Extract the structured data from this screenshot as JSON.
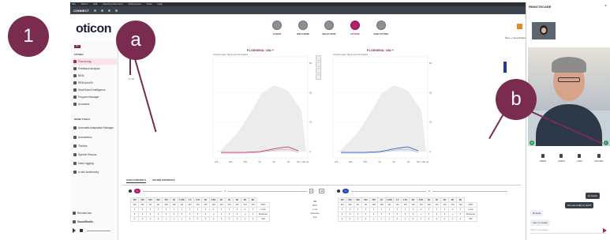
{
  "callouts": {
    "one": "1",
    "a": "a",
    "b": "b"
  },
  "menubar": [
    "File",
    "Oticon",
    "Edit",
    "Hearing Instrument",
    "Preferences",
    "Tools",
    "Help"
  ],
  "toolbar": {
    "connect": "CONNECT"
  },
  "logo": "oticon",
  "steps": [
    {
      "label": "CLIENT"
    },
    {
      "label": "WELCOME"
    },
    {
      "label": "SELECTION"
    },
    {
      "label": "FITTING"
    },
    {
      "label": "END FITTING"
    }
  ],
  "more_label": "More + Specifications",
  "sidebar": {
    "tab": "R1",
    "fitting_header": "FITTING",
    "items": [
      "Fine-tuning",
      "Feedback Analysis",
      "REM",
      "REM AutoFit",
      "MoreSound Intelligence",
      "Program Manager",
      "Acoustics"
    ],
    "more_tools_header": "MORE TOOLS",
    "tools": [
      "Automatic Adaptation Manager",
      "Autometrics",
      "Tinnitus",
      "Speech Rescue",
      "Data Logging",
      "In-situ Audiometry"
    ],
    "remotecare": "RemoteCare",
    "soundstudio": "SoundStudio"
  },
  "left_value": "75 dB",
  "charts": [
    {
      "title": "P1-GENERAL 'ANL+'",
      "subtitle": "Insertion gain Target and Simulated",
      "yticks": [
        "60",
        "40",
        "20",
        "0"
      ],
      "xticks": [
        "125",
        "250",
        "500",
        "1K",
        "2K",
        "4K",
        "8K / 10K Hz"
      ],
      "color": "#b0206b"
    },
    {
      "title": "P1-GENERAL 'ANL+'",
      "subtitle": "Insertion gain Target and Simulated",
      "yticks": [
        "60",
        "40",
        "20",
        "0"
      ],
      "xticks": [
        "125",
        "250",
        "500",
        "1K",
        "2K",
        "4K",
        "8K / 10K Hz"
      ],
      "color": "#1f4fb0"
    }
  ],
  "tabs": {
    "gain": "GAIN CONTROLS",
    "sound": "SOUND CONTROLS"
  },
  "sliders": {
    "left_pill": "1",
    "right_pill": "1",
    "mid_left": "3",
    "mid_right": "24",
    "end_left": "3",
    "end_right": "3"
  },
  "table": {
    "header": [
      "125",
      "250",
      "500",
      "500",
      "750",
      "1K",
      "1.25K",
      "1.5",
      "1.7K",
      "2K",
      "2.5K",
      "3K",
      "4K",
      "5K",
      "6K",
      "8K"
    ],
    "rows": [
      {
        "name": "MPO",
        "values": [
          "102",
          "102",
          "96",
          "96",
          "108",
          "108",
          "111",
          "113",
          "115",
          "115",
          "120",
          "120",
          "113",
          "110",
          "104",
          "104"
        ]
      },
      {
        "name": "Loud",
        "values": [
          "0",
          "0",
          "0",
          "0",
          "0",
          "1",
          "1",
          "0",
          "1",
          "0",
          "0",
          "0",
          "0",
          "0",
          "0",
          "0"
        ]
      },
      {
        "name": "Moderate",
        "values": [
          "0",
          "0",
          "0",
          "0",
          "0",
          "0",
          "0",
          "0",
          "0",
          "0",
          "-1",
          "0",
          "0",
          "0",
          "-1",
          "0"
        ]
      },
      {
        "name": "Soft",
        "values": [
          "0",
          "0",
          "0",
          "0",
          "1",
          "1",
          "1",
          "2",
          "2",
          "3",
          "0",
          "0",
          "0",
          "0",
          "0",
          "0"
        ]
      }
    ],
    "mid_all": "All",
    "mid_labels": [
      "MPO",
      "Loud",
      "Moderate",
      "Soft"
    ]
  },
  "remotecare": {
    "title": "REMOTECARE",
    "controls": [
      "VIDEO",
      "AUDIO",
      "CHAT",
      "UPLOAD"
    ],
    "chats": [
      {
        "text": "Hi Jacob",
        "side": "r"
      },
      {
        "text": "Are you ready to start?",
        "side": "r"
      },
      {
        "text": "Hi Jane",
        "side": "l"
      },
      {
        "text": "Yes, I'm ready",
        "side": "l"
      }
    ],
    "placeholder": "Type a message..."
  },
  "badge_left": "R",
  "badge_right": "L"
}
